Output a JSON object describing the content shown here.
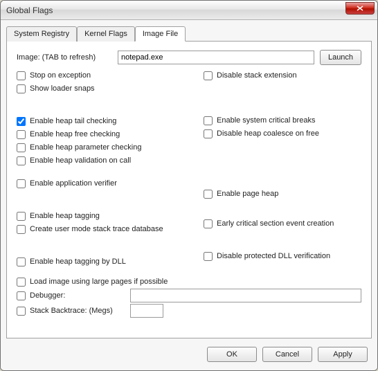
{
  "window": {
    "title": "Global Flags"
  },
  "tabs": {
    "system_registry": "System Registry",
    "kernel_flags": "Kernel Flags",
    "image_file": "Image File"
  },
  "image_row": {
    "label": "Image: (TAB to refresh)",
    "value": "notepad.exe",
    "launch": "Launch"
  },
  "left": {
    "stop_on_exception": "Stop on exception",
    "show_loader_snaps": "Show loader snaps",
    "heap_tail": "Enable heap tail checking",
    "heap_free": "Enable heap free checking",
    "heap_param": "Enable heap parameter checking",
    "heap_valid": "Enable heap validation on call",
    "app_verifier": "Enable application verifier",
    "heap_tagging": "Enable heap tagging",
    "umdh": "Create user mode stack trace database",
    "heap_tag_dll": "Enable heap tagging by DLL",
    "large_pages": "Load image using large pages if possible",
    "debugger": "Debugger:",
    "stack_backtrace": "Stack Backtrace: (Megs)"
  },
  "right": {
    "disable_stack_ext": "Disable stack extension",
    "sys_crit_breaks": "Enable system critical breaks",
    "disable_coalesce": "Disable heap coalesce on free",
    "page_heap": "Enable page heap",
    "early_crit": "Early critical section event creation",
    "disable_dll_verif": "Disable protected DLL verification"
  },
  "buttons": {
    "ok": "OK",
    "cancel": "Cancel",
    "apply": "Apply"
  }
}
